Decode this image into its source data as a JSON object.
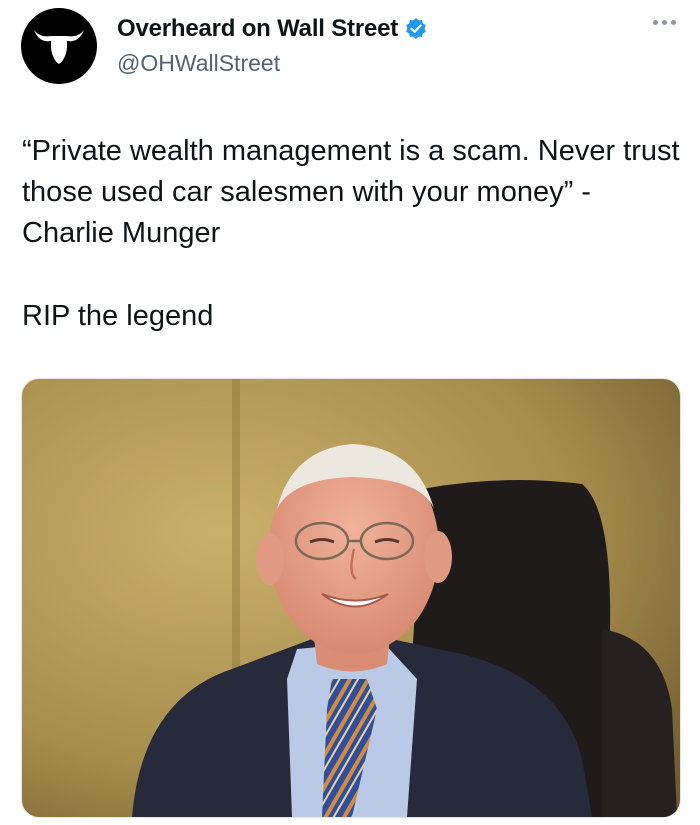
{
  "account": {
    "name": "Overheard on Wall Street",
    "handle": "@OHWallStreet",
    "verified_color": "#1d9bf0",
    "avatar_icon": "bull-head-icon"
  },
  "tweet": {
    "quote": "“Private wealth management is a scam. Never trust those used car salesmen with your money” - Charlie Munger",
    "closing": "RIP the legend"
  },
  "media": {
    "icon": "photo-of-smiling-elderly-man-icon"
  }
}
